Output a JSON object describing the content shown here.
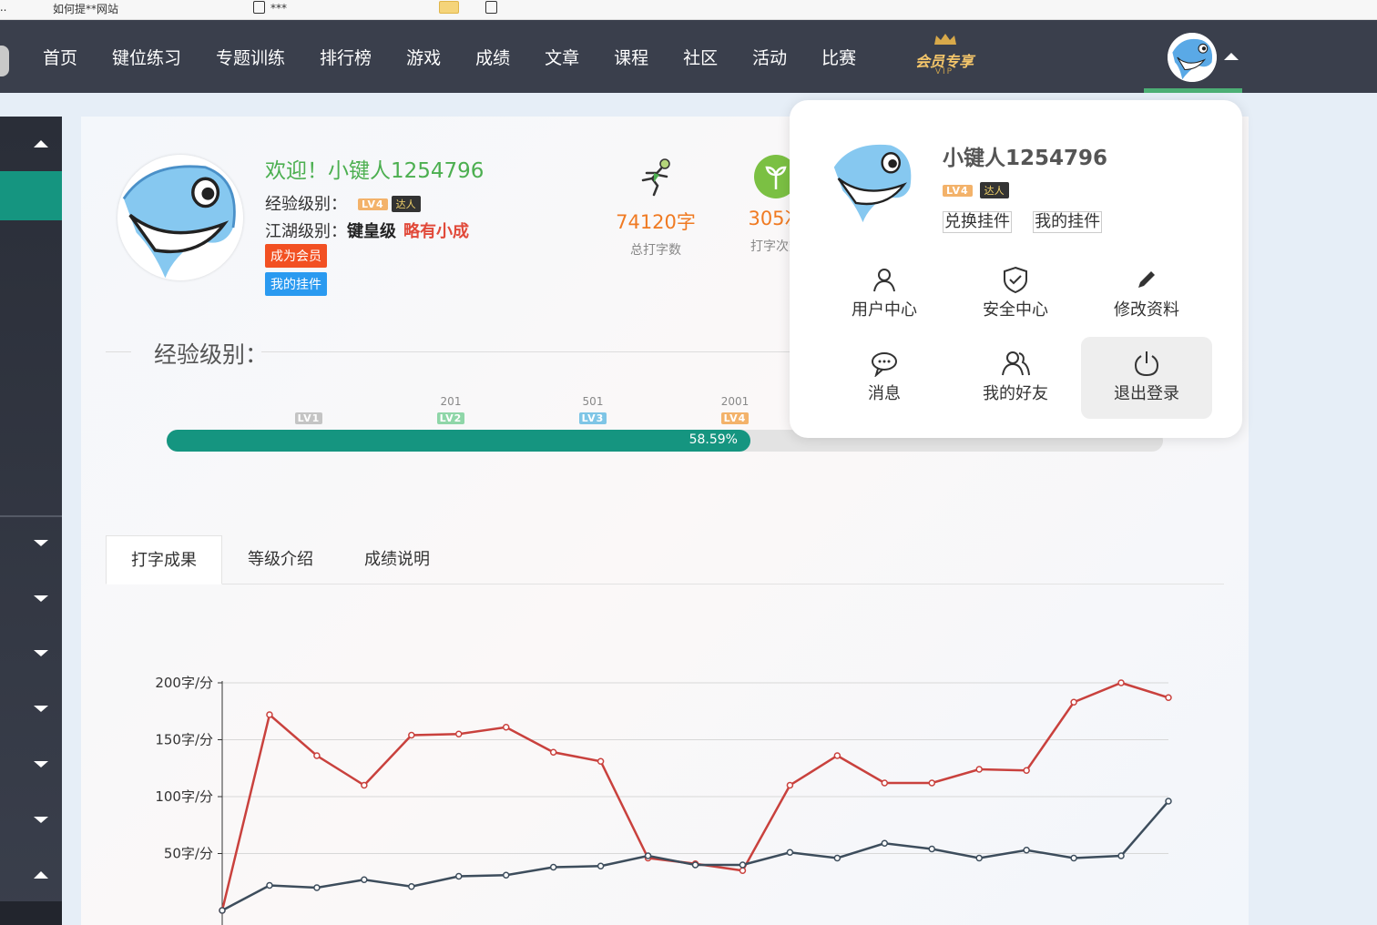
{
  "browser": {
    "bookmarks": [
      "如何提**网站",
      "***",
      "..."
    ]
  },
  "nav": {
    "items": [
      "首页",
      "键位练习",
      "专题训练",
      "排行榜",
      "游戏",
      "成绩",
      "文章",
      "课程",
      "社区",
      "活动",
      "比赛"
    ],
    "vip_label": "会员专享",
    "vip_sub": "VIP"
  },
  "profile": {
    "welcome": "欢迎！小键人1254796",
    "exp_label": "经验级别：",
    "jh_label": "江湖级别：",
    "jh_level": "键皇级",
    "jh_rank": "略有小成",
    "lv_tag": "LV4",
    "title_tag": "达人",
    "btn_member": "成为会员",
    "btn_pendant": "我的挂件"
  },
  "stats": [
    {
      "value": "74120字",
      "label": "总打字数",
      "icon": "runner-icon"
    },
    {
      "value": "305次",
      "label": "打字次数",
      "icon": "sprout-icon"
    }
  ],
  "exp_section": {
    "title": "经验级别：",
    "levels": [
      {
        "num": "",
        "tag": "LV1",
        "color": "#c4c4c4"
      },
      {
        "num": "201",
        "tag": "LV2",
        "color": "#8fd6a8"
      },
      {
        "num": "501",
        "tag": "LV3",
        "color": "#7ec5e6"
      },
      {
        "num": "2001",
        "tag": "LV4",
        "color": "#f3b26a"
      }
    ],
    "progress_percent": 58.59,
    "progress_label": "58.59%"
  },
  "tabs": [
    "打字成果",
    "等级介绍",
    "成绩说明"
  ],
  "chart_data": {
    "type": "line",
    "yunit": "字/分",
    "y_ticks": [
      "200字/分",
      "150字/分",
      "100字/分",
      "50字/分"
    ],
    "ylim": [
      0,
      200
    ],
    "grid": true,
    "series": [
      {
        "color": "#c9413d",
        "values": [
          0,
          172,
          136,
          110,
          154,
          155,
          161,
          139,
          131,
          46,
          41,
          35,
          110,
          136,
          112,
          112,
          124,
          123,
          183,
          200,
          187
        ]
      },
      {
        "color": "#3d4d5c",
        "values": [
          0,
          22,
          20,
          27,
          21,
          30,
          31,
          38,
          39,
          48,
          40,
          40,
          51,
          46,
          59,
          54,
          46,
          53,
          46,
          48,
          96
        ]
      }
    ]
  },
  "dropdown": {
    "name": "小键人1254796",
    "lv_tag": "LV4",
    "title_tag": "达人",
    "link_exchange": "兑换挂件",
    "link_pendant": "我的挂件",
    "menu": [
      {
        "label": "用户中心",
        "icon": "user-icon"
      },
      {
        "label": "安全中心",
        "icon": "shield-icon"
      },
      {
        "label": "修改资料",
        "icon": "pencil-icon"
      },
      {
        "label": "消息",
        "icon": "message-icon"
      },
      {
        "label": "我的好友",
        "icon": "friends-icon"
      },
      {
        "label": "退出登录",
        "icon": "power-icon"
      }
    ]
  }
}
